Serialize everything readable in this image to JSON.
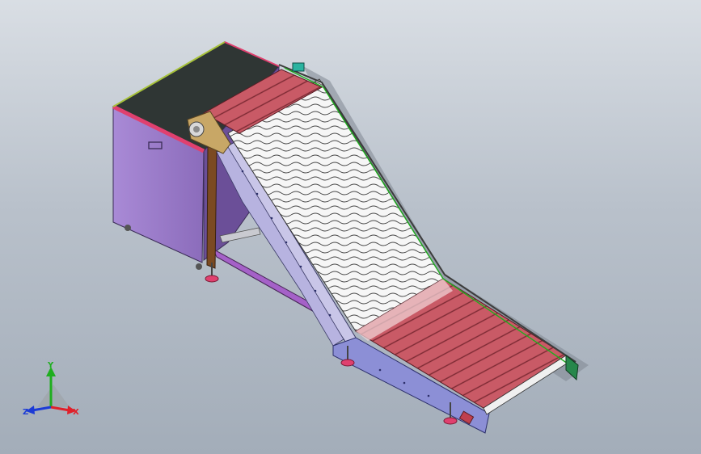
{
  "viewport": {
    "background_top": "#d9dee4",
    "background_bottom": "#a3adb9"
  },
  "model": {
    "bin_color": "#9a79c9",
    "bin_interior": "#2e3533",
    "rim_color": "#e0406f",
    "conveyor_frame_color": "#8c8fd6",
    "belt_slat_color": "#c95a66",
    "belt_light_color": "#f4f4f4",
    "bracket_color": "#c8a766",
    "foot_color": "#e0406f"
  },
  "triad": {
    "y_label": "Y",
    "x_label": "X",
    "z_label": "Z",
    "y_color": "#1fae1f",
    "x_color": "#e0202a",
    "z_color": "#1c3bd6"
  }
}
